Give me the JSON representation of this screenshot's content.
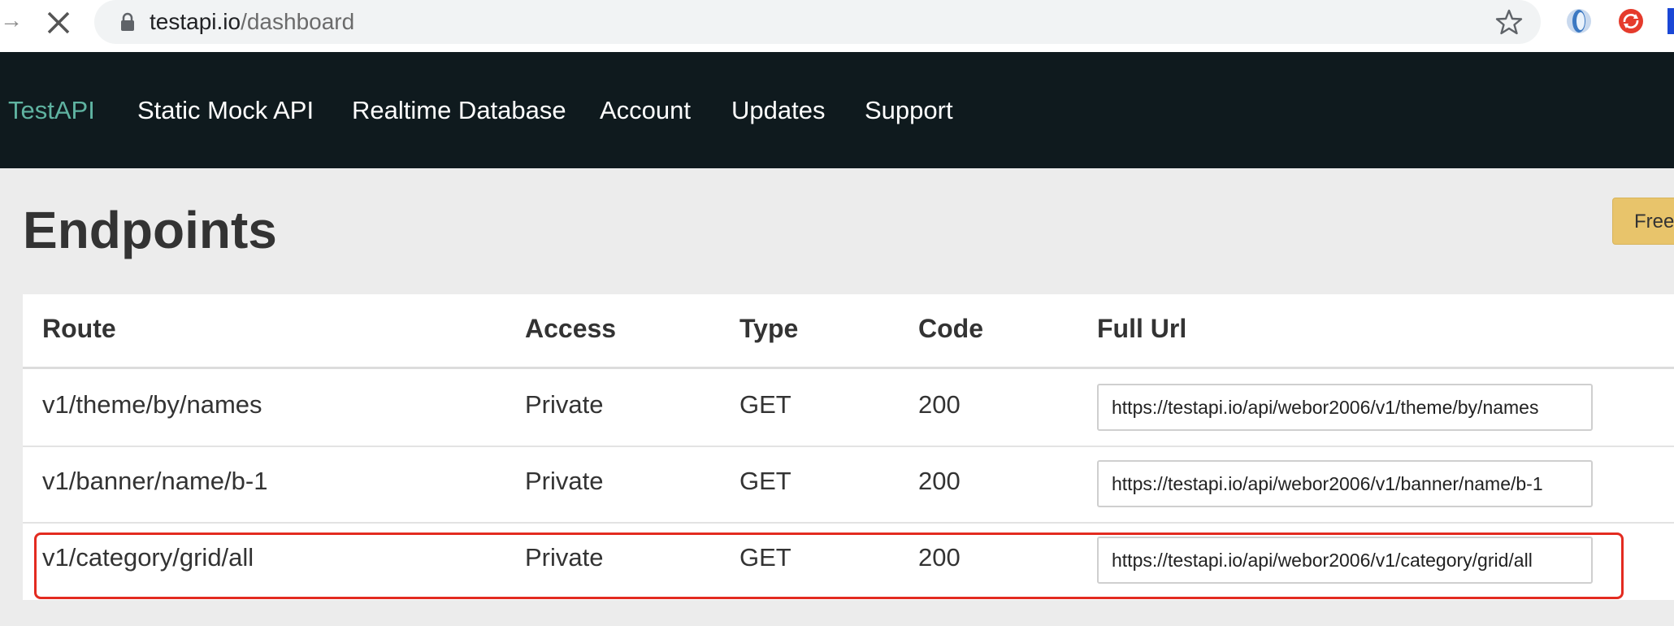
{
  "browser": {
    "url_host": "testapi.io",
    "url_path": "/dashboard"
  },
  "navbar": {
    "brand": "TestAPI",
    "items": [
      {
        "label": "Static Mock API"
      },
      {
        "label": "Realtime Database"
      },
      {
        "label": "Account"
      },
      {
        "label": "Updates"
      },
      {
        "label": "Support"
      }
    ]
  },
  "main": {
    "title": "Endpoints",
    "plan_badge": "Free"
  },
  "table": {
    "headers": {
      "route": "Route",
      "access": "Access",
      "type": "Type",
      "code": "Code",
      "full_url": "Full Url"
    },
    "rows": [
      {
        "route": "v1/theme/by/names",
        "access": "Private",
        "type": "GET",
        "code": "200",
        "full_url": "https://testapi.io/api/webor2006/v1/theme/by/names"
      },
      {
        "route": "v1/banner/name/b-1",
        "access": "Private",
        "type": "GET",
        "code": "200",
        "full_url": "https://testapi.io/api/webor2006/v1/banner/name/b-1"
      },
      {
        "route": "v1/category/grid/all",
        "access": "Private",
        "type": "GET",
        "code": "200",
        "full_url": "https://testapi.io/api/webor2006/v1/category/grid/all"
      }
    ]
  },
  "colors": {
    "navbar_bg": "#0f1a1e",
    "brand": "#5fb3a1",
    "badge_bg": "#e8c46b",
    "highlight": "#e32b20"
  }
}
